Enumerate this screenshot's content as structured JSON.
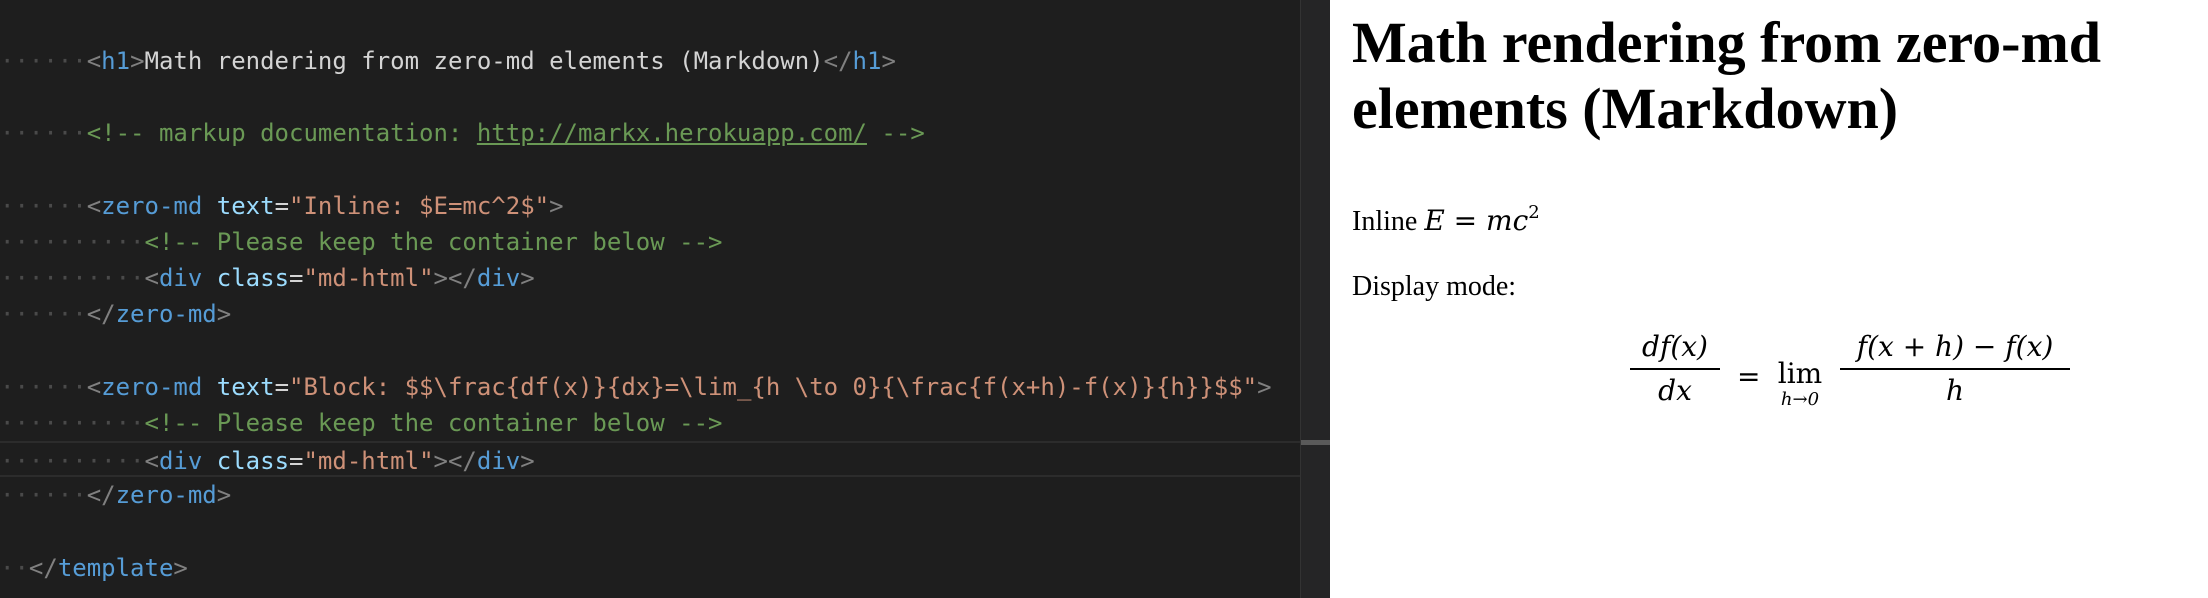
{
  "editor": {
    "lines": [
      {
        "ws": "······",
        "parts": [
          [
            "br",
            "<"
          ],
          [
            "tag",
            "h1"
          ],
          [
            "br",
            ">"
          ],
          [
            "txt",
            "Math rendering from zero-md elements (Markdown)"
          ],
          [
            "br",
            "</"
          ],
          [
            "tag",
            "h1"
          ],
          [
            "br",
            ">"
          ]
        ]
      },
      {
        "ws": "",
        "parts": []
      },
      {
        "ws": "······",
        "parts": [
          [
            "com",
            "<!-- markup documentation: "
          ],
          [
            "link",
            "http://markx.herokuapp.com/"
          ],
          [
            "com",
            " -->"
          ]
        ]
      },
      {
        "ws": "",
        "parts": []
      },
      {
        "ws": "······",
        "parts": [
          [
            "br",
            "<"
          ],
          [
            "tag",
            "zero-md"
          ],
          [
            "txt",
            " "
          ],
          [
            "attr",
            "text"
          ],
          [
            "txt",
            "="
          ],
          [
            "str",
            "\"Inline: $E=mc^2$\""
          ],
          [
            "br",
            ">"
          ]
        ]
      },
      {
        "ws": "··········",
        "parts": [
          [
            "com",
            "<!-- Please keep the container below -->"
          ]
        ]
      },
      {
        "ws": "··········",
        "parts": [
          [
            "br",
            "<"
          ],
          [
            "tag",
            "div"
          ],
          [
            "txt",
            " "
          ],
          [
            "attr",
            "class"
          ],
          [
            "txt",
            "="
          ],
          [
            "str",
            "\"md-html\""
          ],
          [
            "br",
            "></"
          ],
          [
            "tag",
            "div"
          ],
          [
            "br",
            ">"
          ]
        ]
      },
      {
        "ws": "······",
        "parts": [
          [
            "br",
            "</"
          ],
          [
            "tag",
            "zero-md"
          ],
          [
            "br",
            ">"
          ]
        ]
      },
      {
        "ws": "",
        "parts": []
      },
      {
        "ws": "······",
        "parts": [
          [
            "br",
            "<"
          ],
          [
            "tag",
            "zero-md"
          ],
          [
            "txt",
            " "
          ],
          [
            "attr",
            "text"
          ],
          [
            "txt",
            "="
          ],
          [
            "str",
            "\"Block: $$\\frac{df(x)}{dx}=\\lim_{h \\to 0}{\\frac{f(x+h)-f(x)}{h}}$$\""
          ],
          [
            "br",
            ">"
          ]
        ]
      },
      {
        "ws": "··········",
        "parts": [
          [
            "com",
            "<!-- Please keep the container below -->"
          ]
        ]
      },
      {
        "ws": "··········",
        "parts": [
          [
            "br",
            "<"
          ],
          [
            "tag",
            "div"
          ],
          [
            "txt",
            " "
          ],
          [
            "attr",
            "class"
          ],
          [
            "txt",
            "="
          ],
          [
            "str",
            "\"md-html\""
          ],
          [
            "br",
            "></"
          ],
          [
            "tag",
            "div"
          ],
          [
            "br",
            ">"
          ]
        ],
        "current": true
      },
      {
        "ws": "······",
        "parts": [
          [
            "br",
            "</"
          ],
          [
            "tag",
            "zero-md"
          ],
          [
            "br",
            ">"
          ]
        ]
      },
      {
        "ws": "",
        "parts": []
      },
      {
        "ws": "··",
        "parts": [
          [
            "br",
            "</"
          ],
          [
            "tag",
            "template"
          ],
          [
            "br",
            ">"
          ]
        ]
      }
    ]
  },
  "preview": {
    "title": "Math rendering from zero-md elements (Markdown)",
    "inline_label": "Inline",
    "inline_math": {
      "lhs": "E",
      "eq": "=",
      "rhs_base": "mc",
      "rhs_sup": "2"
    },
    "display_label": "Display mode:",
    "display_math": {
      "frac1_num": "df(x)",
      "frac1_den": "dx",
      "eq": "=",
      "lim": "lim",
      "lim_sub": "h→0",
      "frac2_num": "f(x + h) − f(x)",
      "frac2_den": "h"
    }
  }
}
